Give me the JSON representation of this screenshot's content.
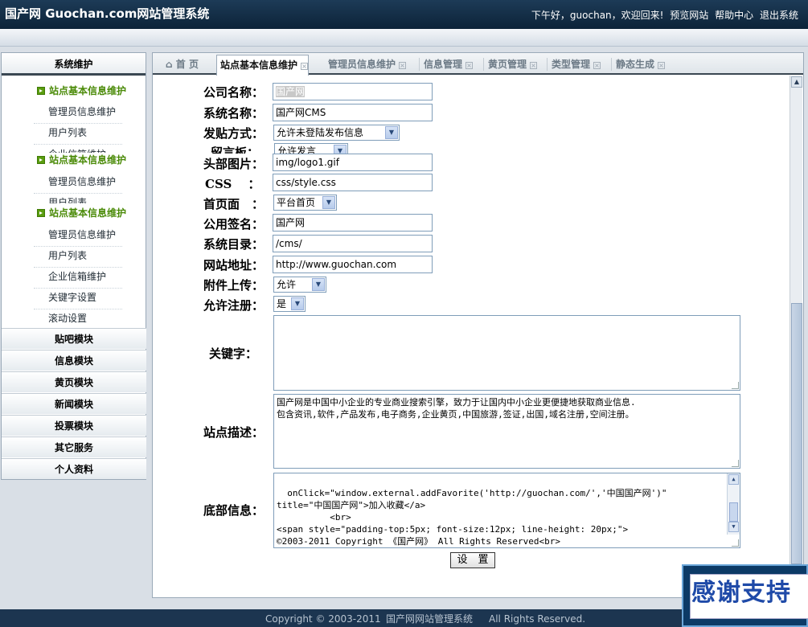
{
  "header": {
    "logo": "国产网 Guochan.com网站管理系统",
    "greeting": "下午好，guochan，欢迎回来!",
    "links": [
      "预览网站",
      "帮助中心",
      "退出系统"
    ]
  },
  "sidebar": {
    "head": "系统维护",
    "groups": [
      {
        "title": "站点基本信息维护",
        "items": [
          "管理员信息维护",
          "用户列表",
          "企业信箱维护"
        ]
      },
      {
        "title": "站点基本信息维护",
        "items": [
          "管理员信息维护",
          "用户列表"
        ]
      },
      {
        "title": "站点基本信息维护",
        "items": [
          "管理员信息维护",
          "用户列表",
          "企业信箱维护",
          "关键字设置",
          "滚动设置"
        ]
      }
    ],
    "modules": [
      "贴吧模块",
      "信息模块",
      "黄页模块",
      "新闻模块",
      "投票模块",
      "其它服务",
      "个人资料"
    ]
  },
  "tabs": [
    {
      "label": "首 页",
      "icon": "home-icon"
    },
    {
      "label": "站点基本信息维护"
    },
    {
      "label": "管理员信息维护"
    },
    {
      "label": "信息管理"
    },
    {
      "label": "黄页管理"
    },
    {
      "label": "类型管理"
    },
    {
      "label": "静态生成"
    }
  ],
  "form": {
    "company_label": "公司名称：",
    "company_value": "国产网",
    "sysname_label": "系统名称：",
    "sysname_value": "国产网CMS",
    "postmode_label": "发贴方式：",
    "postmode_value": "允许未登陆发布信息",
    "guestbook_label": "留言板：",
    "guestbook_value": "允许发言",
    "headimg_label": "头部图片：",
    "headimg_value": "img/logo1.gif",
    "css_label": "CSS　 ：",
    "css_value": "css/style.css",
    "homepage_label": "首页面　：",
    "homepage_value": "平台首页",
    "signature_label": "公用签名：",
    "signature_value": "国产网",
    "sysdir_label": "系统目录：",
    "sysdir_value": "/cms/",
    "url_label": "网站地址：",
    "url_value": "http://www.guochan.com",
    "upload_label": "附件上传：",
    "upload_value": "允许",
    "register_label": "允许注册：",
    "register_value": "是",
    "keywords_label": "关键字：",
    "keywords_value": "",
    "desc_label": "站点描述：",
    "desc_value": "国产网是中国中小企业的专业商业搜索引擎，致力于让国内中小企业更便捷地获取商业信息.\n包含资讯,软件,产品发布,电子商务,企业黄页,中国旅游,签证,出国,域名注册,空间注册。",
    "footer_label": "底部信息：",
    "footer_value": "onClick=\"window.external.addFavorite('http://guochan.com/','中国国产网')\"\ntitle=\"中国国产网\">加入收藏</a>\n          <br>\n<span style=\"padding-top:5px; font-size:12px; line-height: 20px;\">\n©2003-2011 Copyright 《国产网》 All Rights Reserved<br>\n            Powered by guochan.com</span>",
    "submit": "设　置"
  },
  "footer": {
    "copyright": "Copyright © 2003-2011",
    "name": "国产网网站管理系统",
    "rights": "All Rights Reserved."
  },
  "promo": "感谢支持"
}
